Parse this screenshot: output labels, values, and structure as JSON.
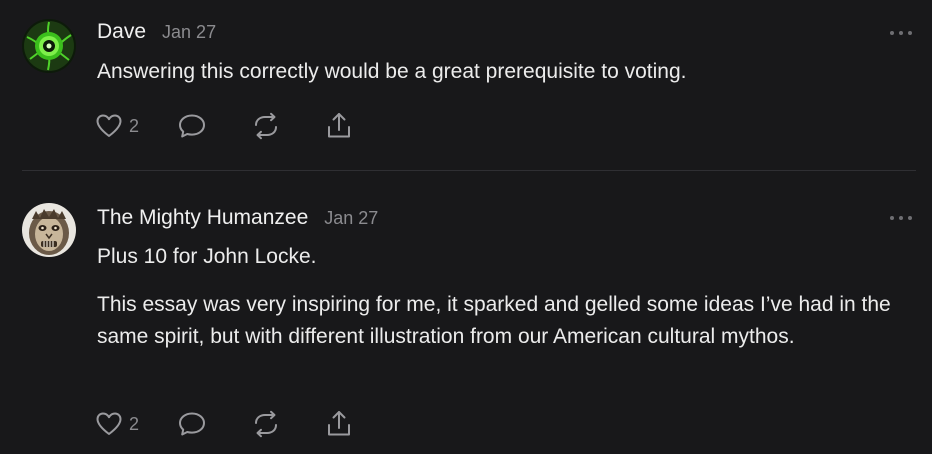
{
  "comments": [
    {
      "author": "Dave",
      "date": "Jan 27",
      "paragraphs": [
        "Answering this correctly would be a great prerequisite to voting."
      ],
      "likes": "2",
      "avatar_icon": "green-eye-icon"
    },
    {
      "author": "The Mighty Humanzee",
      "date": "Jan 27",
      "paragraphs": [
        "Plus 10 for John Locke.",
        "This essay was very inspiring for me, it sparked and gelled some ideas I’ve had in the same spirit, but with different illustration from our American cultural mythos."
      ],
      "likes": "2",
      "avatar_icon": "humanzee-face-icon"
    }
  ],
  "icons": {
    "like": "heart-icon",
    "reply": "speech-bubble-icon",
    "restack": "restack-icon",
    "share": "share-icon",
    "more": "more-icon"
  },
  "colors": {
    "background": "#18181a",
    "text": "#ececec",
    "muted": "#8b8b8f",
    "divider": "#2f2f33",
    "icon": "#9a9a9e"
  }
}
